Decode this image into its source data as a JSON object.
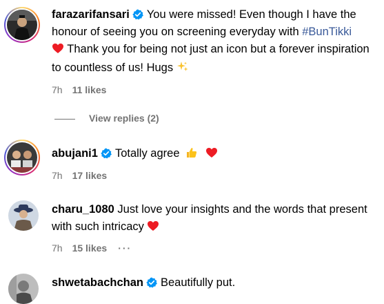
{
  "comments": [
    {
      "username": "farazarifansari",
      "verified": true,
      "text_1": "You were missed! Even though I have the honour of seeing you on screening everyday with ",
      "hashtag": "#BunTikki",
      "text_2": " Thank you for being not just an icon but a forever inspiration to countless of us! Hugs",
      "emoji_1": "❤️",
      "emoji_2": "✨",
      "time": "7h",
      "likes": "11 likes"
    },
    {
      "username": "abujani1",
      "verified": true,
      "text": "Totally agree",
      "emoji_1": "👍",
      "emoji_2": "❤️",
      "time": "7h",
      "likes": "17 likes"
    },
    {
      "username": "charu_1080",
      "verified": false,
      "text": "Just love your insights and the words that present with such intricacy",
      "emoji_1": "❤️",
      "time": "7h",
      "likes": "15 likes",
      "more": "···"
    },
    {
      "username": "shwetabachchan",
      "verified": true,
      "text": "Beautifully put."
    }
  ],
  "view_replies": "View replies (2)",
  "colors": {
    "verified_blue": "#0095f6",
    "hashtag": "#385898",
    "meta_gray": "#737373",
    "heart_red": "#ed1c24"
  },
  "icons": {
    "verified": "verified-badge-icon",
    "heart": "red-heart-icon",
    "thumbs_up": "thumbs-up-icon",
    "sparkles": "sparkles-icon",
    "more": "more-options-icon"
  }
}
